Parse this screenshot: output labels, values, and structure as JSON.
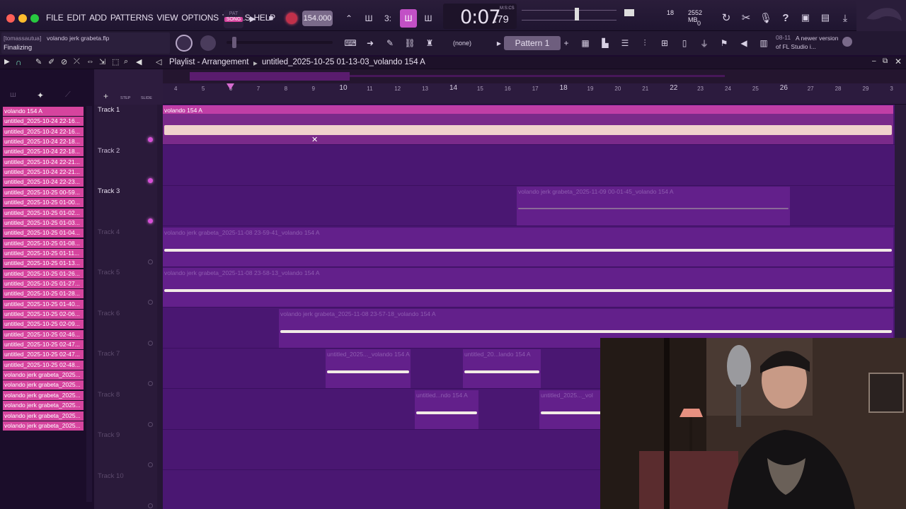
{
  "menu": [
    "FILE",
    "EDIT",
    "ADD",
    "PATTERNS",
    "VIEW",
    "OPTIONS",
    "TOOLS",
    "HELP"
  ],
  "mode": {
    "pat": "PAT",
    "song": "SONG"
  },
  "tempo": "154.000",
  "time": {
    "main": "0:07",
    "sub": ":79",
    "label": "M:S:CS"
  },
  "cpu": {
    "voices": "18",
    "mem": "2552 MB",
    "zero": "0"
  },
  "project": {
    "user": "[tomassautua]",
    "file": "volando jerk grabeta.flp",
    "status": "Finalizing"
  },
  "pattern_selector": {
    "channel": "(none)",
    "pattern": "Pattern 1"
  },
  "news": {
    "date": "08-11",
    "text": "A newer version of FL Studio i..."
  },
  "playlist": {
    "title": "Playlist - Arrangement",
    "breadcrumb": "untitled_2025-10-25 01-13-03_volando 154 A",
    "step": "STEP",
    "slide": "SLIDE"
  },
  "ruler": [
    "4",
    "5",
    "6",
    "7",
    "8",
    "9",
    "10",
    "11",
    "12",
    "13",
    "14",
    "15",
    "16",
    "17",
    "18",
    "19",
    "20",
    "21",
    "22",
    "23",
    "24",
    "25",
    "26",
    "27",
    "28",
    "29",
    "3"
  ],
  "browser_items": [
    "volando 154 A",
    "untitled_2025-10-24 22-16...",
    "untitled_2025-10-24 22-16...",
    "untitled_2025-10-24 22-18...",
    "untitled_2025-10-24 22-18...",
    "untitled_2025-10-24 22-21...",
    "untitled_2025-10-24 22-21...",
    "untitled_2025-10-24 22-23...",
    "untitled_2025-10-25 00-59...",
    "untitled_2025-10-25 01-00...",
    "untitled_2025-10-25 01-02...",
    "untitled_2025-10-25 01-03...",
    "untitled_2025-10-25 01-04...",
    "untitled_2025-10-25 01-08...",
    "untitled_2025-10-25 01-11...",
    "untitled_2025-10-25 01-13...",
    "untitled_2025-10-25 01-26...",
    "untitled_2025-10-25 01-27...",
    "untitled_2025-10-25 01-28...",
    "untitled_2025-10-25 01-40...",
    "untitled_2025-10-25 02-06...",
    "untitled_2025-10-25 02-09...",
    "untitled_2025-10-25 02-46...",
    "untitled_2025-10-25 02-47...",
    "untitled_2025-10-25 02-47...",
    "untitled_2025-10-25 02-48...",
    "volando jerk grabeta_2025...",
    "volando jerk grabeta_2025...",
    "volando jerk grabeta_2025...",
    "volando jerk grabeta_2025...",
    "volando jerk grabeta_2025...",
    "volando jerk grabeta_2025..."
  ],
  "tracks": [
    "Track 1",
    "Track 2",
    "Track 3",
    "Track 4",
    "Track 5",
    "Track 6",
    "Track 7",
    "Track 8",
    "Track 9",
    "Track 10"
  ],
  "clips": [
    "volando 154 A",
    "volando jerk grabeta_2025-11-09 00-01-45_volando 154 A",
    "volando jerk grabeta_2025-11-08 23-59-41_volando 154 A",
    "volando jerk grabeta_2025-11-08 23-58-13_volando 154 A",
    "volando jerk grabeta_2025-11-08 23-57-18_volando 154 A",
    "untitled_2025..._volando 154 A",
    "untitled_20...lando 154 A",
    "untitled...ndo 154 A",
    "untitled_2025..._vol"
  ],
  "colors": {
    "accent": "#d6449e",
    "lane": "#4a1772",
    "bg": "#1c0a2e"
  }
}
